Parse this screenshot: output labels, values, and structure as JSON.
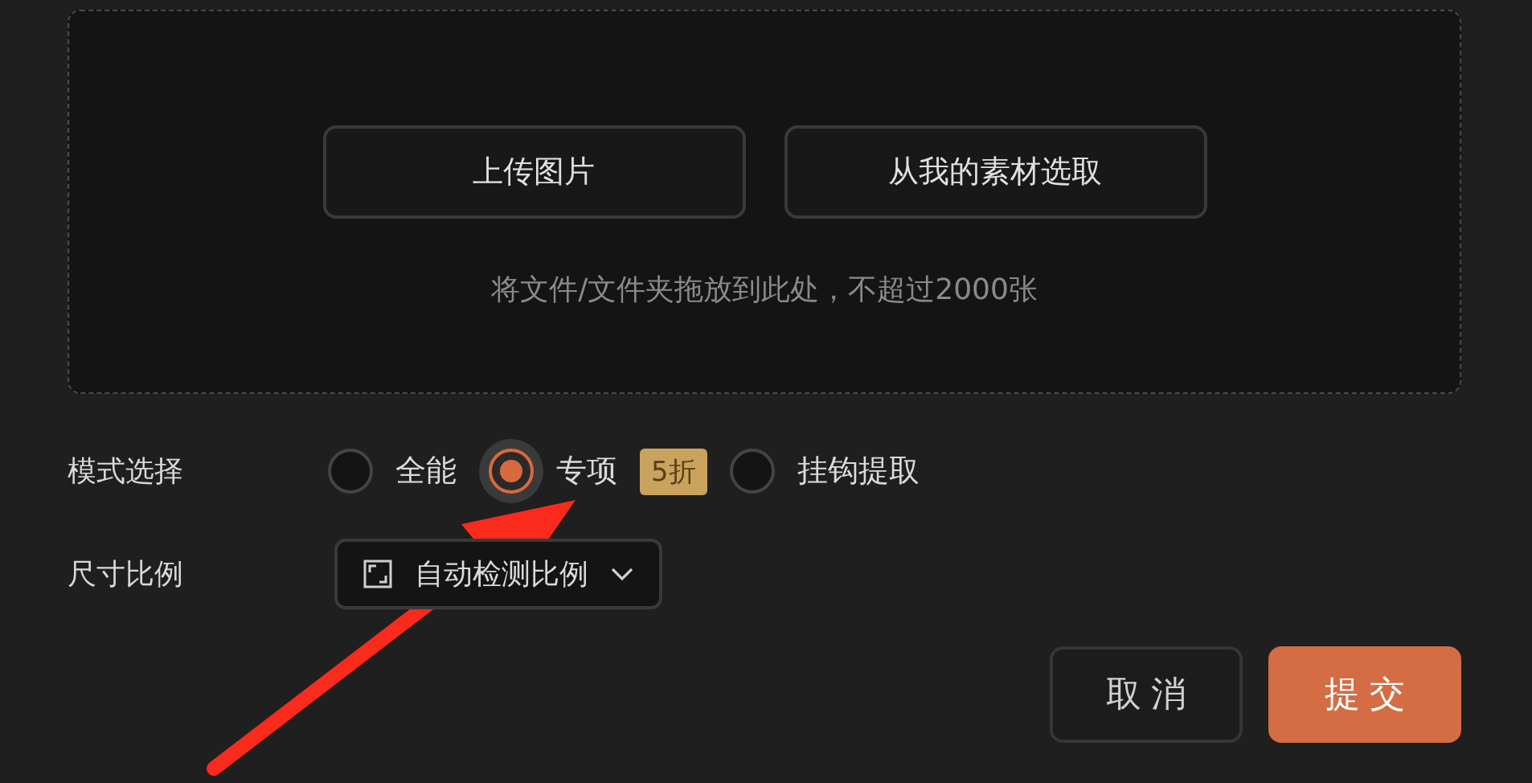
{
  "upload": {
    "buttons": [
      "上传图片",
      "从我的素材选取"
    ],
    "hint": "将文件/文件夹拖放到此处，不超过2000张"
  },
  "mode": {
    "label": "模式选择",
    "options": [
      {
        "label": "全能",
        "selected": false
      },
      {
        "label": "专项",
        "selected": true,
        "badge": "5折"
      },
      {
        "label": "挂钩提取",
        "selected": false
      }
    ]
  },
  "size": {
    "label": "尺寸比例",
    "value": "自动检测比例"
  },
  "actions": [
    {
      "label": "取消",
      "kind": "secondary"
    },
    {
      "label": "提交",
      "kind": "primary"
    }
  ],
  "annotation": {
    "kind": "arrow"
  }
}
